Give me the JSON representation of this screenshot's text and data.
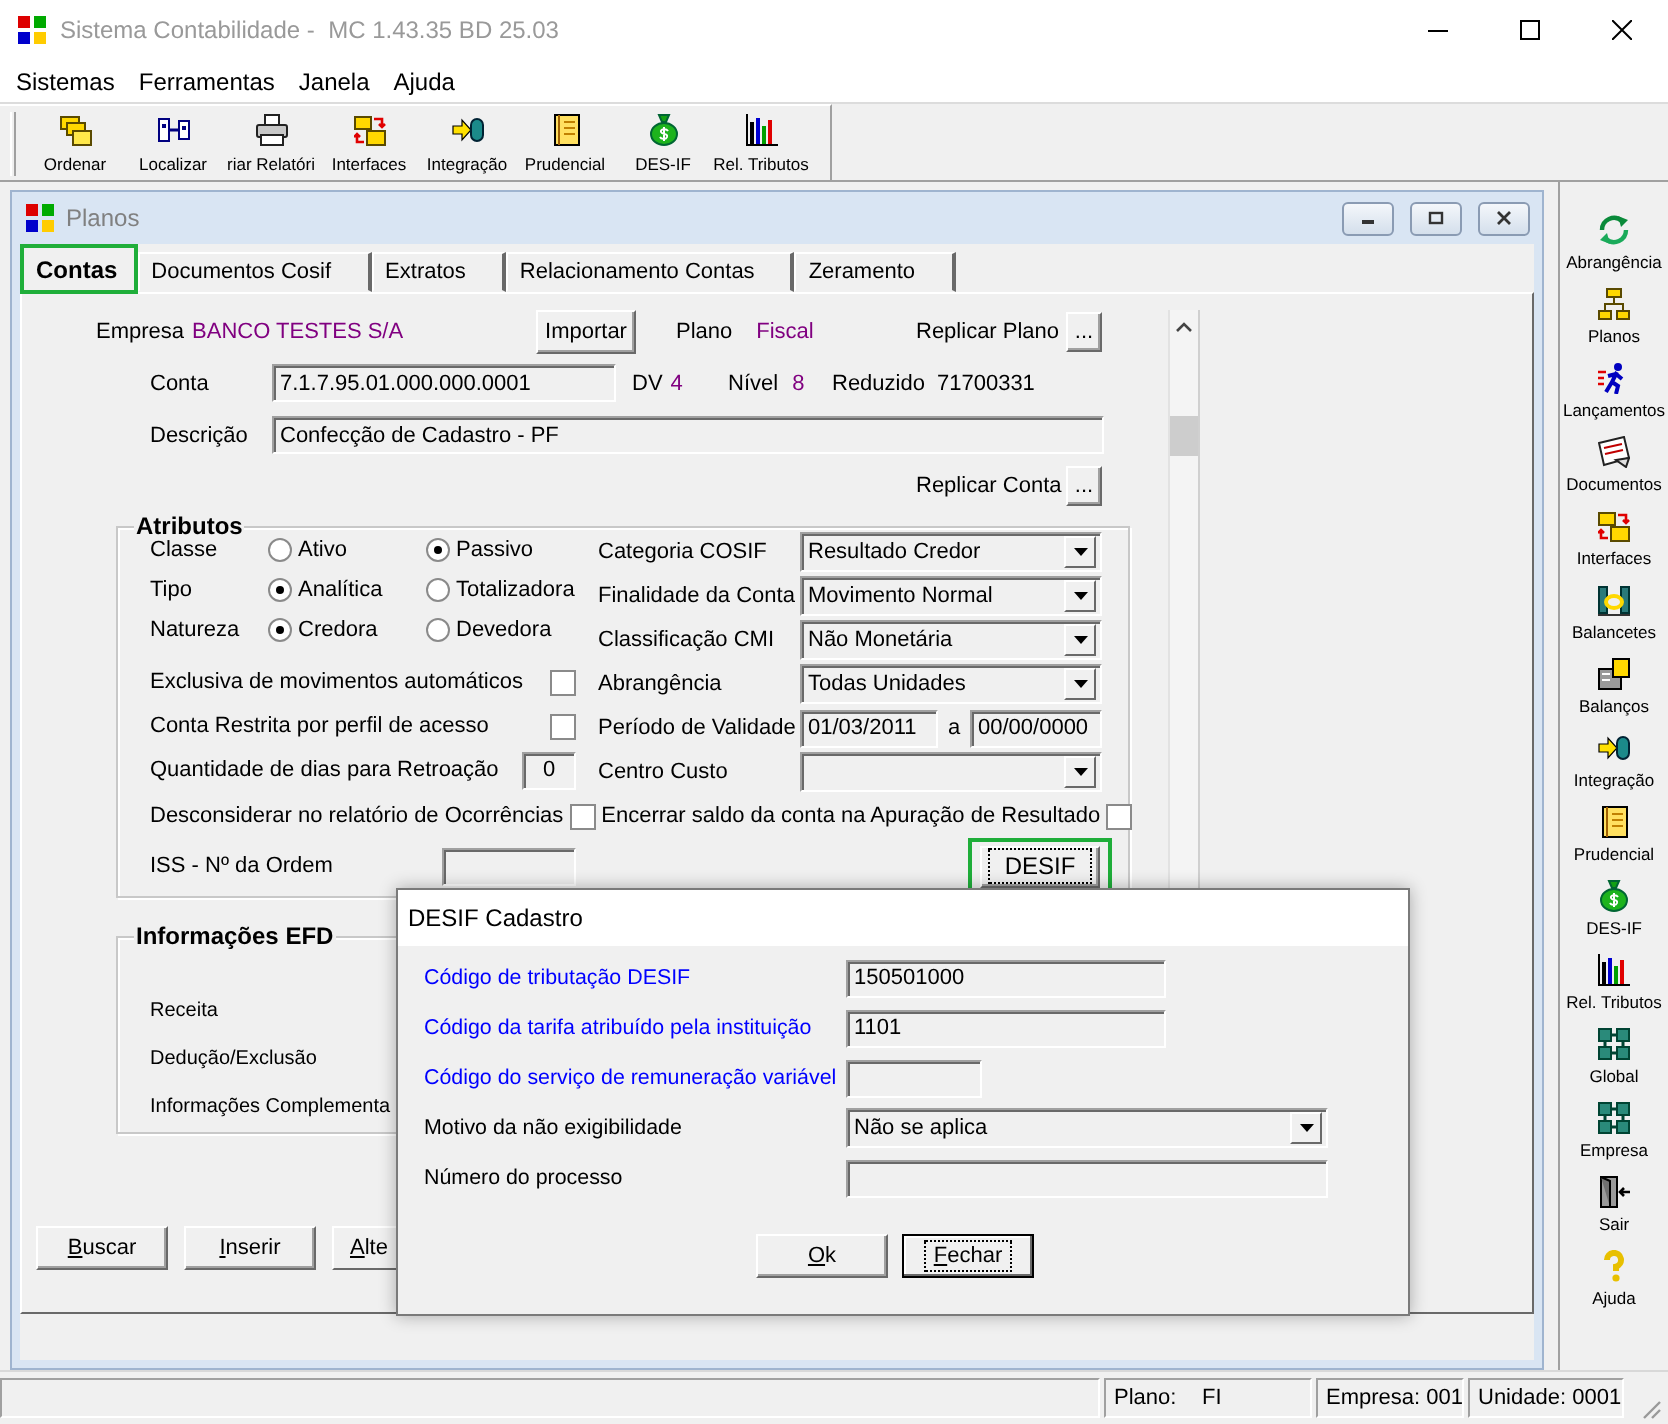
{
  "window": {
    "title": "Sistema Contabilidade -  MC 1.43.35 BD 25.03"
  },
  "menu": [
    "Sistemas",
    "Ferramentas",
    "Janela",
    "Ajuda"
  ],
  "toolbar": [
    "Ordenar",
    "Localizar",
    "riar Relatóri",
    "Interfaces",
    "Integração",
    "Prudencial",
    "DES-IF",
    "Rel. Tributos"
  ],
  "child_window": {
    "title": "Planos"
  },
  "tabs": [
    {
      "label": "Contas",
      "selected": true,
      "highlighted": true
    },
    {
      "label": "Documentos Cosif",
      "selected": false,
      "highlighted": false
    },
    {
      "label": "Extratos",
      "selected": false,
      "highlighted": false
    },
    {
      "label": "Relacionamento Contas",
      "selected": false,
      "highlighted": false
    },
    {
      "label": "Zeramento",
      "selected": false,
      "highlighted": false
    }
  ],
  "header": {
    "empresa": {
      "label": "Empresa",
      "value": "BANCO TESTES S/A"
    },
    "import_button": "Importar",
    "plano": {
      "label": "Plano",
      "value": "Fiscal"
    },
    "replicar_plano": {
      "label": "Replicar Plano",
      "button": "..."
    },
    "conta": {
      "label": "Conta",
      "value": "7.1.7.95.01.000.000.0001"
    },
    "dv": {
      "label": "DV",
      "value": "4"
    },
    "nivel": {
      "label": "Nível",
      "value": "8"
    },
    "reduzido": {
      "label": "Reduzido",
      "value": "71700331"
    },
    "descricao": {
      "label": "Descrição",
      "value": "Confecção de Cadastro - PF"
    },
    "replicar_conta": {
      "label": "Replicar Conta",
      "button": "..."
    }
  },
  "atributos": {
    "title": "Atributos",
    "radio_groups": [
      {
        "label": "Classe",
        "options": [
          {
            "label": "Ativo",
            "selected": false
          },
          {
            "label": "Passivo",
            "selected": true
          }
        ]
      },
      {
        "label": "Tipo",
        "options": [
          {
            "label": "Analítica",
            "selected": true
          },
          {
            "label": "Totalizadora",
            "selected": false
          }
        ]
      },
      {
        "label": "Natureza",
        "options": [
          {
            "label": "Credora",
            "selected": true
          },
          {
            "label": "Devedora",
            "selected": false
          }
        ]
      }
    ],
    "checks": [
      {
        "label": "Exclusiva de movimentos automáticos",
        "checked": false
      },
      {
        "label": "Conta Restrita por perfil de acesso",
        "checked": false
      }
    ],
    "retroacao": {
      "label": "Quantidade de dias para Retroação",
      "value": "0"
    },
    "fields": [
      {
        "kind": "select",
        "label": "Categoria COSIF",
        "value": "Resultado Credor"
      },
      {
        "kind": "select",
        "label": "Finalidade da Conta",
        "value": "Movimento Normal"
      },
      {
        "kind": "select",
        "label": "Classificação CMI",
        "value": "Não Monetária"
      },
      {
        "kind": "select",
        "label": "Abrangência",
        "value": "Todas Unidades"
      },
      {
        "kind": "range",
        "label": "Período de Validade",
        "from": "01/03/2011",
        "separator": "a",
        "to": "00/00/0000"
      },
      {
        "kind": "select",
        "label": "Centro Custo"
      }
    ],
    "flags": [
      {
        "label": "Desconsiderar no relatório de Ocorrências",
        "checked": false
      },
      {
        "label": "Encerrar saldo da conta na Apuração de Resultado",
        "checked": false
      }
    ],
    "iss": {
      "label": "ISS - Nº da Ordem"
    },
    "desif_button": {
      "label": "DESIF",
      "focused": true,
      "highlighted": true
    }
  },
  "efd": {
    "title": "Informações EFD",
    "rows": [
      "Receita",
      "Dedução/Exclusão",
      "Informações Complementa"
    ]
  },
  "actions": [
    "Buscar",
    "Inserir",
    "Alte"
  ],
  "dialog": {
    "title": "DESIF Cadastro",
    "fields": [
      {
        "label": "Código de tributação DESIF",
        "kind": "code",
        "value": "150501000",
        "color": "#0000ff"
      },
      {
        "label": "Código da tarifa atribuído pela instituição",
        "kind": "code",
        "value": "1101",
        "color": "#0000ff"
      },
      {
        "label": "Código do serviço de remuneração variável",
        "kind": "short",
        "color": "#0000ff"
      },
      {
        "label": "Motivo da não exigibilidade",
        "kind": "select",
        "value": "Não se aplica",
        "color": "#000000"
      },
      {
        "label": "Número do processo",
        "kind": "text",
        "color": "#000000"
      }
    ],
    "buttons": [
      {
        "label": "Ok",
        "focused": false
      },
      {
        "label": "Fechar",
        "focused": true
      }
    ]
  },
  "sidebar": [
    "Abrangência",
    "Planos",
    "Lançamentos",
    "Documentos",
    "Interfaces",
    "Balancetes",
    "Balanços",
    "Integração",
    "Prudencial",
    "DES-IF",
    "Rel. Tributos",
    "Global",
    "Empresa",
    "Sair",
    "Ajuda"
  ],
  "status_bar": {
    "plano_label": "Plano:",
    "plano_value": "FI",
    "empresa": "Empresa: 001",
    "unidade": "Unidade: 0001"
  }
}
